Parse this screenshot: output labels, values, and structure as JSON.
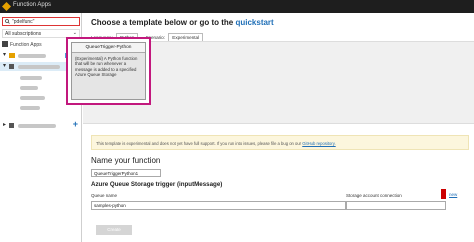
{
  "app": {
    "title": "Function Apps"
  },
  "sidebar": {
    "search_value": "\"pdelfunc\"",
    "subscription": "All subscriptions",
    "function_apps_label": "Function Apps"
  },
  "main": {
    "heading_prefix": "Choose a template below or go to the",
    "quickstart_link": "quickstart",
    "language_label": "Language:",
    "language_value": "Python",
    "scenario_label": "Scenario:",
    "scenario_value": "Experimental"
  },
  "template": {
    "title": "QueueTrigger-Python",
    "description": "(Experimental) A Python function that will be run whenever a message is added to a specified Azure Queue Storage"
  },
  "banner": {
    "text": "This template is experimental and does not yet have full support. If you run into issues, please file a bug on our",
    "link": "GitHub repository."
  },
  "form": {
    "name_heading": "Name your function",
    "name_value": "QueueTriggerPython1",
    "trigger_heading": "Azure Queue Storage trigger (inputMessage)",
    "queue_label": "Queue name",
    "queue_value": "samples-python",
    "storage_label": "Storage account connection",
    "new_link": "new",
    "create_label": "Create"
  },
  "colors": {
    "accent": "#1f6fb7",
    "highlight": "#c2187d",
    "error": "#cc0000"
  }
}
